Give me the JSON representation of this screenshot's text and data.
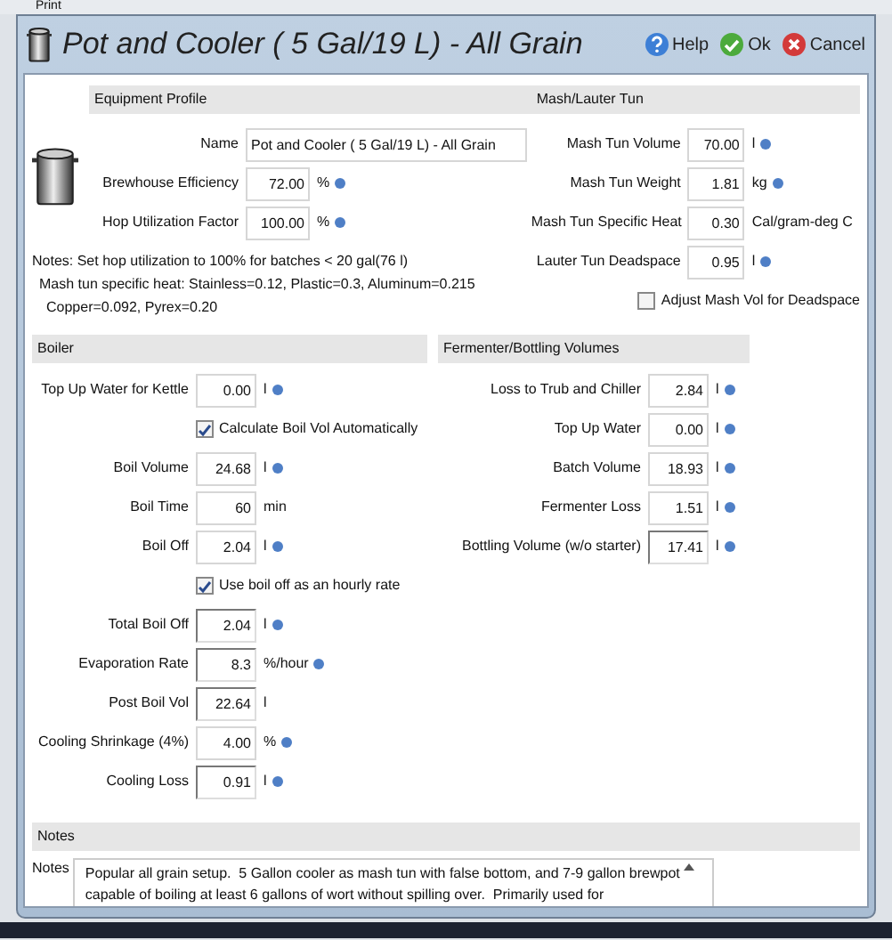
{
  "background_toolbar": {
    "label": "Print"
  },
  "window": {
    "title": "Pot and Cooler ( 5 Gal/19 L) - All Grain",
    "buttons": [
      {
        "kind": "help",
        "label": "Help"
      },
      {
        "kind": "ok",
        "label": "Ok"
      },
      {
        "kind": "cancel",
        "label": "Cancel"
      }
    ]
  },
  "equipment_profile": {
    "heading": "Equipment Profile",
    "fields": [
      {
        "label": "Name",
        "value": "Pot and Cooler ( 5 Gal/19 L) - All Grain",
        "info": false,
        "readonly": false
      },
      {
        "label": "Brewhouse Efficiency",
        "value": "72.00",
        "unit": "%",
        "info": true,
        "readonly": false
      },
      {
        "label": "Hop Utilization Factor",
        "value": "100.00",
        "unit": "%",
        "info": true,
        "readonly": false
      }
    ],
    "notes": [
      "Notes: Set hop utilization to 100% for batches < 20 gal(76 l)",
      "Mash tun specific heat: Stainless=0.12, Plastic=0.3, Aluminum=0.215",
      "Copper=0.092, Pyrex=0.20"
    ]
  },
  "mash_lauter_tun": {
    "heading": "Mash/Lauter Tun",
    "items": [
      {
        "kind": "field",
        "label": "Mash Tun Volume",
        "value": "70.00",
        "unit": "l",
        "info": true,
        "readonly": false
      },
      {
        "kind": "field",
        "label": "Mash Tun Weight",
        "value": "1.81",
        "unit": "kg",
        "info": true,
        "readonly": false
      },
      {
        "kind": "field",
        "label": "Mash Tun Specific Heat",
        "value": "0.30",
        "unit": "Cal/gram-deg C",
        "info": false,
        "readonly": false
      },
      {
        "kind": "field",
        "label": "Lauter Tun Deadspace",
        "value": "0.95",
        "unit": "l",
        "info": true,
        "readonly": false
      },
      {
        "kind": "checkbox",
        "label": "Adjust Mash Vol for Deadspace",
        "checked": false
      }
    ]
  },
  "boiler": {
    "heading": "Boiler",
    "items": [
      {
        "kind": "field",
        "label": "Top Up Water for Kettle",
        "value": "0.00",
        "unit": "l",
        "info": true,
        "readonly": false
      },
      {
        "kind": "checkbox",
        "label": "Calculate Boil Vol Automatically",
        "checked": true
      },
      {
        "kind": "field",
        "label": "Boil Volume",
        "value": "24.68",
        "unit": "l",
        "info": true,
        "readonly": false
      },
      {
        "kind": "field",
        "label": "Boil Time",
        "value": "60",
        "unit": "min",
        "info": false,
        "readonly": false
      },
      {
        "kind": "field",
        "label": "Boil Off",
        "value": "2.04",
        "unit": "l",
        "info": true,
        "readonly": false
      },
      {
        "kind": "checkbox",
        "label": "Use boil off as an hourly rate",
        "checked": true
      },
      {
        "kind": "field",
        "label": "Total Boil Off",
        "value": "2.04",
        "unit": "l",
        "info": true,
        "readonly": true
      },
      {
        "kind": "field",
        "label": "Evaporation Rate",
        "value": "8.3",
        "unit": "%/hour",
        "info": true,
        "readonly": true
      },
      {
        "kind": "field",
        "label": "Post Boil Vol",
        "value": "22.64",
        "unit": "l",
        "info": false,
        "readonly": true
      },
      {
        "kind": "field",
        "label": "Cooling Shrinkage (4%)",
        "value": "4.00",
        "unit": "%",
        "info": true,
        "readonly": false
      },
      {
        "kind": "field",
        "label": "Cooling Loss",
        "value": "0.91",
        "unit": "l",
        "info": true,
        "readonly": true
      }
    ]
  },
  "fermenter_bottling_volumes": {
    "heading": "Fermenter/Bottling Volumes",
    "items": [
      {
        "kind": "field",
        "label": "Loss to Trub and Chiller",
        "value": "2.84",
        "unit": "l",
        "info": true,
        "readonly": false
      },
      {
        "kind": "field",
        "label": "Top Up Water",
        "value": "0.00",
        "unit": "l",
        "info": true,
        "readonly": false
      },
      {
        "kind": "field",
        "label": "Batch Volume",
        "value": "18.93",
        "unit": "l",
        "info": true,
        "readonly": false
      },
      {
        "kind": "field",
        "label": "Fermenter Loss",
        "value": "1.51",
        "unit": "l",
        "info": true,
        "readonly": false
      },
      {
        "kind": "field",
        "label": "Bottling Volume (w/o starter)",
        "value": "17.41",
        "unit": "l",
        "info": true,
        "readonly": true
      }
    ]
  },
  "notes_section": {
    "heading": "Notes",
    "label": "Notes",
    "value": "Popular all grain setup.  5 Gallon cooler as mash tun with false bottom, and 7-9 gallon brewpot capable of boiling at least 6 gallons of wort without spilling over.  Primarily used for"
  }
}
